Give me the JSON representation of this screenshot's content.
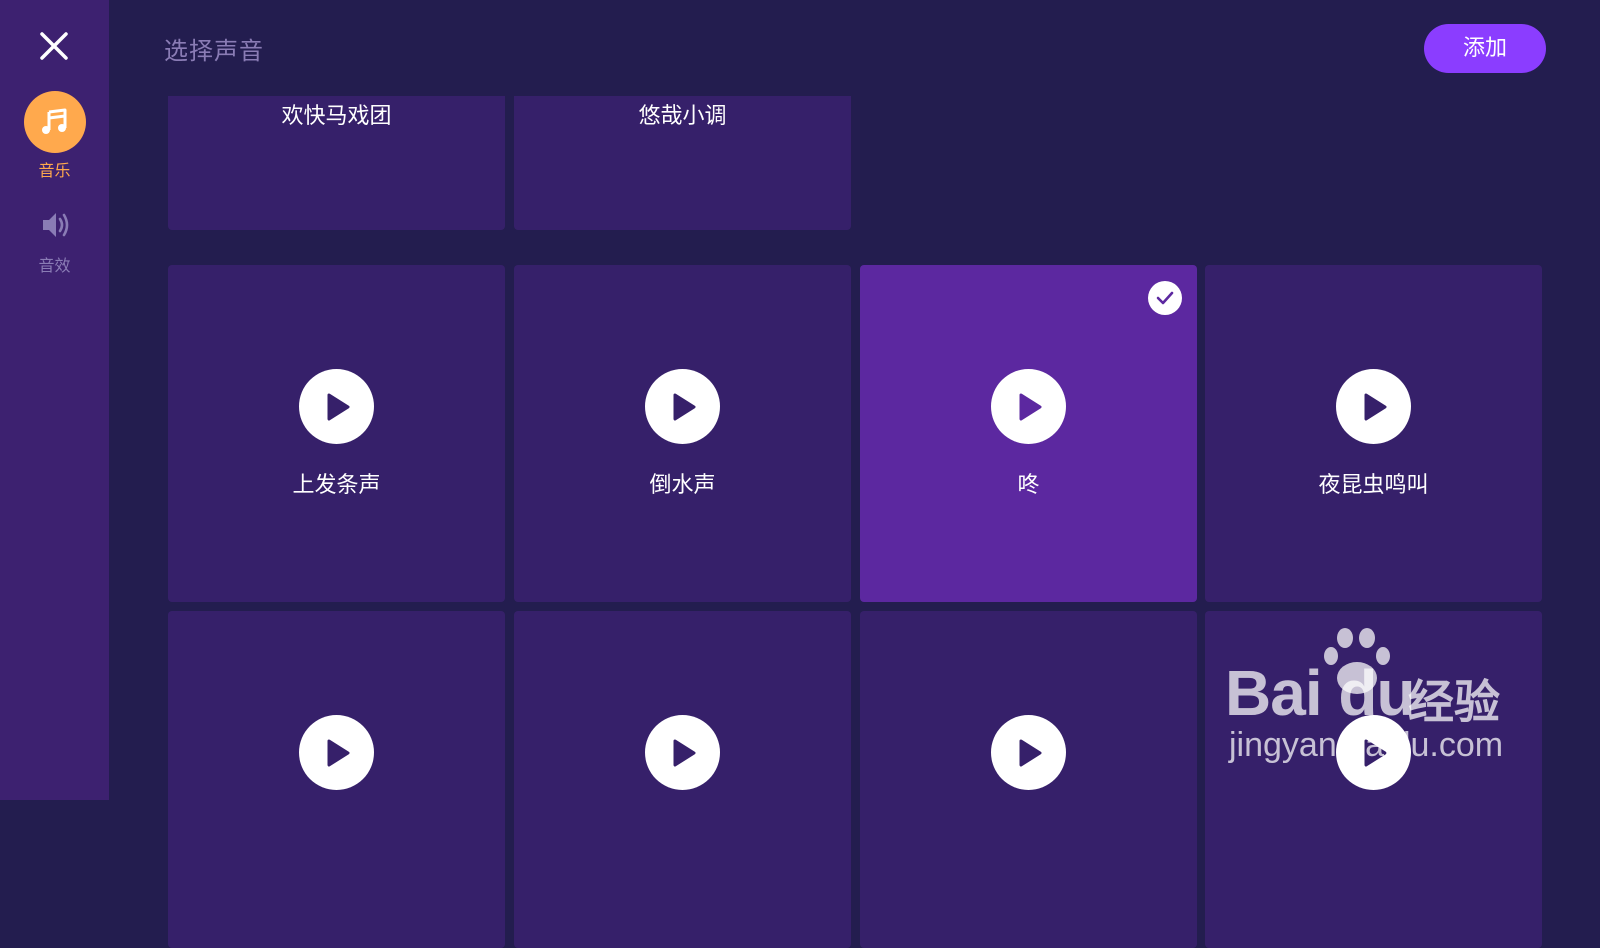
{
  "header": {
    "title": "选择声音",
    "add_label": "添加"
  },
  "sidebar": {
    "close_icon": "close-icon",
    "items": [
      {
        "label": "音乐",
        "icon": "music-note-icon",
        "active": true,
        "color": "#ffa94d"
      },
      {
        "label": "音效",
        "icon": "speaker-icon",
        "active": false
      }
    ]
  },
  "top_row": [
    {
      "label": "欢快马戏团"
    },
    {
      "label": "悠哉小调"
    }
  ],
  "grid": [
    {
      "label": "上发条声",
      "selected": false
    },
    {
      "label": "倒水声",
      "selected": false
    },
    {
      "label": "咚",
      "selected": true
    },
    {
      "label": "夜昆虫鸣叫",
      "selected": false
    },
    {
      "label": "",
      "selected": false
    },
    {
      "label": "",
      "selected": false
    },
    {
      "label": "",
      "selected": false
    },
    {
      "label": "",
      "selected": false
    }
  ],
  "watermark": {
    "brand": "Bai du",
    "suffix": "经验",
    "url": "jingyan.baidu.com"
  },
  "colors": {
    "background": "#231d4f",
    "sidebar": "#3d2170",
    "tile": "#36206a",
    "tile_selected": "#5c28a0",
    "accent": "#8b3dff",
    "music_active": "#ffa94d"
  }
}
